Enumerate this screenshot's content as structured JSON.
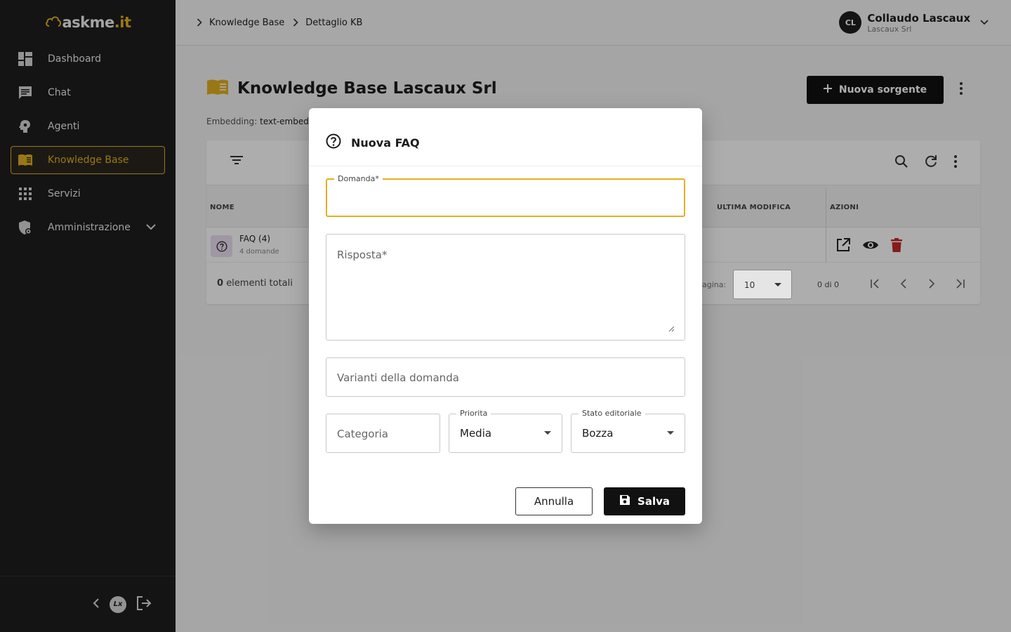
{
  "app": {
    "logo_main": "askme",
    "logo_suffix": ".it"
  },
  "sidebar": {
    "items": [
      {
        "label": "Dashboard",
        "icon": "dashboard-icon"
      },
      {
        "label": "Chat",
        "icon": "chat-icon"
      },
      {
        "label": "Agenti",
        "icon": "agent-icon"
      },
      {
        "label": "Knowledge Base",
        "icon": "book-icon",
        "active": true
      },
      {
        "label": "Servizi",
        "icon": "grid-icon"
      },
      {
        "label": "Amministrazione",
        "icon": "admin-shield-icon"
      }
    ],
    "footer_badge": "Lx"
  },
  "header": {
    "breadcrumbs": [
      "Knowledge Base",
      "Dettaglio KB"
    ],
    "user": {
      "initials": "CL",
      "name": "Collaudo Lascaux",
      "org": "Lascaux Srl"
    }
  },
  "page": {
    "title": "Knowledge Base Lascaux Srl",
    "embedding_label": "Embedding:",
    "embedding_value": "text-embed",
    "new_source_label": "Nuova sorgente"
  },
  "table": {
    "columns": {
      "name": "NOME",
      "modified": "ULTIMA MODIFICA",
      "actions": "AZIONI"
    },
    "rows": [
      {
        "name": "FAQ (4)",
        "sub": "4 domande"
      }
    ],
    "total_count": "0",
    "total_label": "elementi totali",
    "per_page_label": "agina:",
    "per_page_value": "10",
    "range": "0 di 0"
  },
  "dialog": {
    "title": "Nuova FAQ",
    "question_label": "Domanda*",
    "answer_placeholder": "Risposta*",
    "variants_placeholder": "Varianti della domanda",
    "category_placeholder": "Categoria",
    "priority_label": "Priorita",
    "priority_value": "Media",
    "status_label": "Stato editoriale",
    "status_value": "Bozza",
    "cancel_label": "Annulla",
    "save_label": "Salva"
  },
  "colors": {
    "accent": "#e3b021",
    "sidebar_bg": "#1e1e1e",
    "primary_button": "#111111",
    "delete_icon": "#c62828"
  }
}
